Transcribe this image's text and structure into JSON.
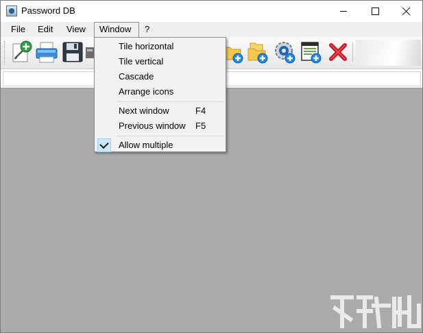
{
  "window": {
    "title": "Password DB"
  },
  "title_buttons": {
    "minimize_icon": "minimize-icon",
    "maximize_icon": "maximize-icon",
    "close_icon": "close-icon"
  },
  "menubar": {
    "items": [
      "File",
      "Edit",
      "View",
      "Window",
      "?"
    ],
    "active": "Window"
  },
  "toolbar": {
    "icons": [
      "new-entry-icon",
      "print-icon",
      "save-icon",
      "cut-icon",
      "add-folder-icon",
      "add-subfolder-icon",
      "add-web-entry-icon",
      "add-card-icon",
      "delete-icon"
    ]
  },
  "window_menu": {
    "items": [
      {
        "label": "Tile horizontal",
        "shortcut": "",
        "checked": false
      },
      {
        "label": "Tile vertical",
        "shortcut": "",
        "checked": false
      },
      {
        "label": "Cascade",
        "shortcut": "",
        "checked": false
      },
      {
        "label": "Arrange icons",
        "shortcut": "",
        "checked": false
      },
      {
        "label": "Next window",
        "shortcut": "F4",
        "checked": false
      },
      {
        "label": "Previous window",
        "shortcut": "F5",
        "checked": false
      },
      {
        "label": "Allow multiple",
        "shortcut": "",
        "checked": true
      }
    ]
  },
  "colors": {
    "workspace": "#ababab",
    "menu_background": "#f2f2f2",
    "check_highlight": "#cce8ff",
    "delete_red": "#c8161d",
    "add_green": "#2ea043",
    "add_blue": "#1e88e5"
  }
}
